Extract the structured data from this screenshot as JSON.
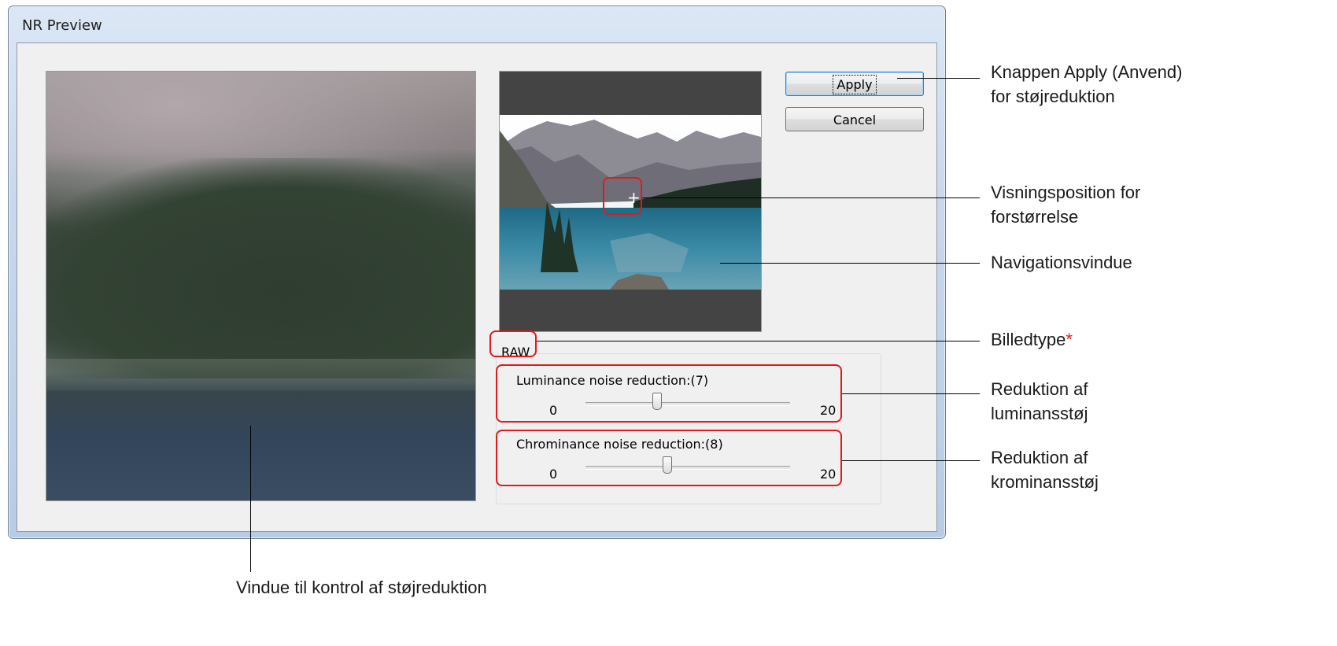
{
  "window": {
    "title": "NR Preview"
  },
  "buttons": {
    "apply": "Apply",
    "cancel": "Cancel"
  },
  "group": {
    "image_type": "RAW"
  },
  "luminance": {
    "label": "Luminance noise reduction:(7)",
    "min": "0",
    "max": "20",
    "value": 7,
    "range": [
      0,
      20
    ]
  },
  "chrominance": {
    "label": "Chrominance noise reduction:(8)",
    "min": "0",
    "max": "20",
    "value": 8,
    "range": [
      0,
      20
    ]
  },
  "annotations": {
    "apply_line1": "Knappen Apply (Anvend)",
    "apply_line2": "for støjreduktion",
    "position_line1": "Visningsposition for",
    "position_line2": "forstørrelse",
    "navigation": "Navigationsvindue",
    "image_type": "Billedtype",
    "image_type_star": "*",
    "luminance_line1": "Reduktion af",
    "luminance_line2": "luminansstøj",
    "chrominance_line1": "Reduktion af",
    "chrominance_line2": "krominansstøj",
    "nr_window": "Vindue til kontrol af støjreduktion"
  },
  "colors": {
    "callout": "#e01a1a",
    "default_button_border": "#3c7fb1"
  }
}
